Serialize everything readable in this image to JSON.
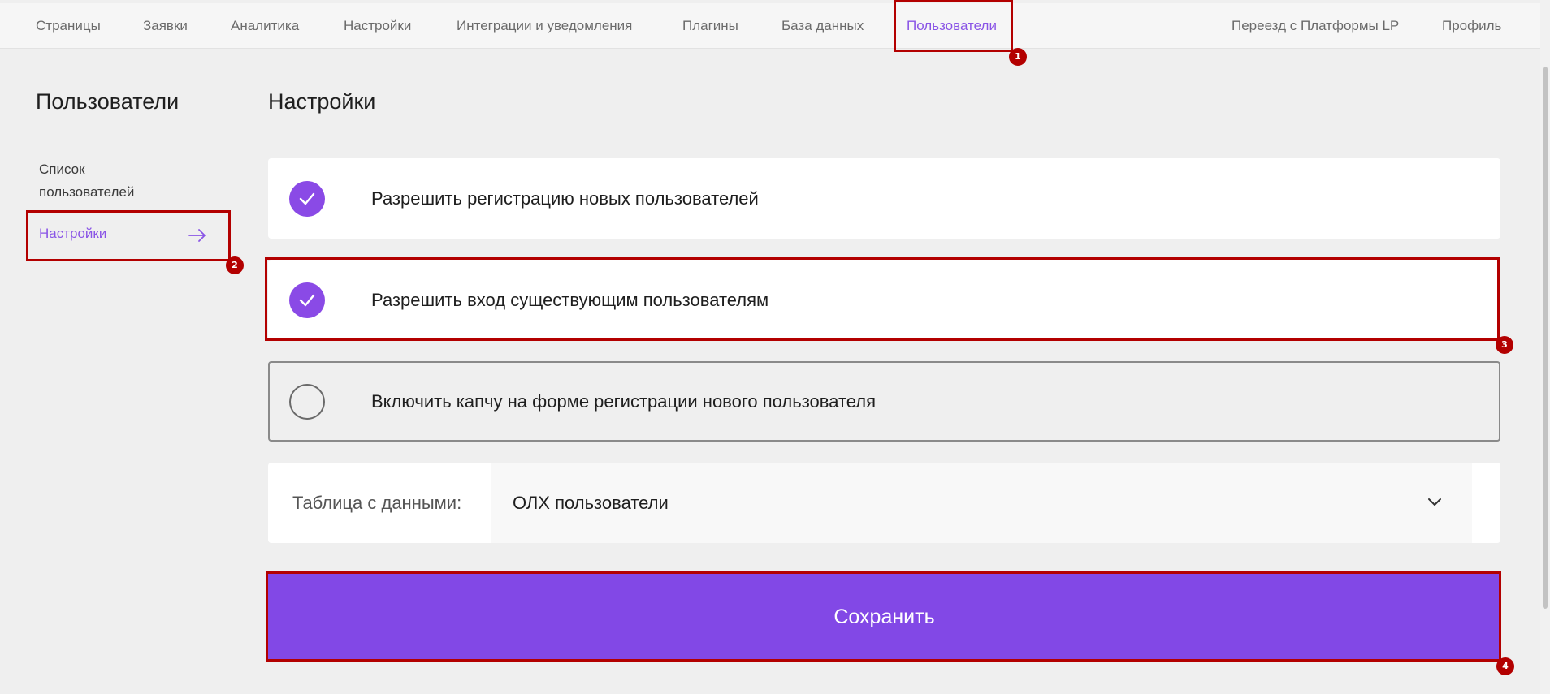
{
  "topnav": {
    "items": [
      {
        "label": "Страницы"
      },
      {
        "label": "Заявки"
      },
      {
        "label": "Аналитика"
      },
      {
        "label": "Настройки"
      },
      {
        "label": "Интеграции и уведомления"
      },
      {
        "label": "Плагины"
      },
      {
        "label": "База данных"
      },
      {
        "label": "Пользователи",
        "active": true
      }
    ],
    "right_items": [
      {
        "label": "Переезд с Платформы LP"
      },
      {
        "label": "Профиль"
      }
    ]
  },
  "sidebar": {
    "title": "Пользователи",
    "items": [
      {
        "label": "Список пользователей"
      },
      {
        "label": "Настройки",
        "active": true
      }
    ]
  },
  "main": {
    "title": "Настройки",
    "options": [
      {
        "label": "Разрешить регистрацию новых пользователей",
        "checked": true
      },
      {
        "label": "Разрешить вход существующим пользователям",
        "checked": true
      },
      {
        "label": "Включить капчу на форме регистрации нового пользователя",
        "checked": false
      }
    ],
    "table_select": {
      "caption": "Таблица с данными:",
      "value": "ОЛХ пользователи"
    },
    "save_label": "Сохранить"
  },
  "annotations": [
    "1",
    "2",
    "3",
    "4"
  ],
  "colors": {
    "accent": "#8248e6",
    "annotation": "#b30000",
    "background": "#efefef"
  }
}
